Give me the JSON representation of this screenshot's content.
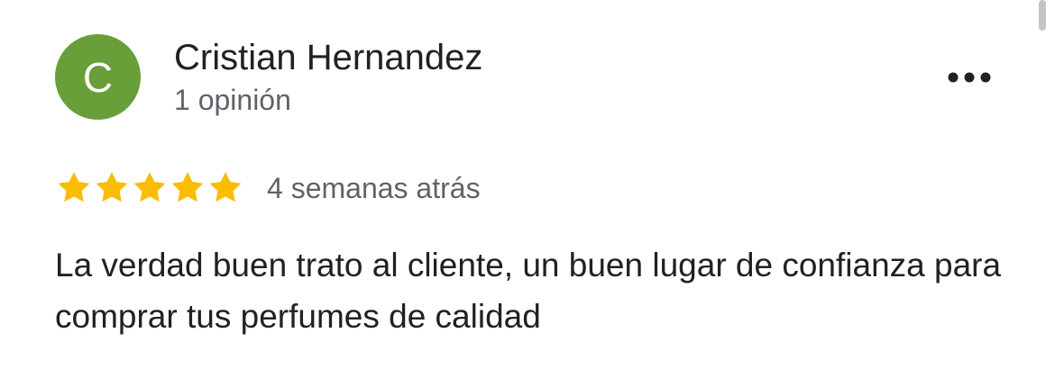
{
  "review": {
    "avatar_letter": "C",
    "avatar_color": "#689f38",
    "author_name": "Cristian Hernandez",
    "review_count": "1 opinión",
    "rating": 5,
    "rating_max": 5,
    "star_color": "#fbbc04",
    "date": "4 semanas atrás",
    "text": "La verdad buen trato al cliente, un buen lugar de confianza para comprar tus perfumes de calidad",
    "more_icon": "more-horizontal-icon"
  }
}
